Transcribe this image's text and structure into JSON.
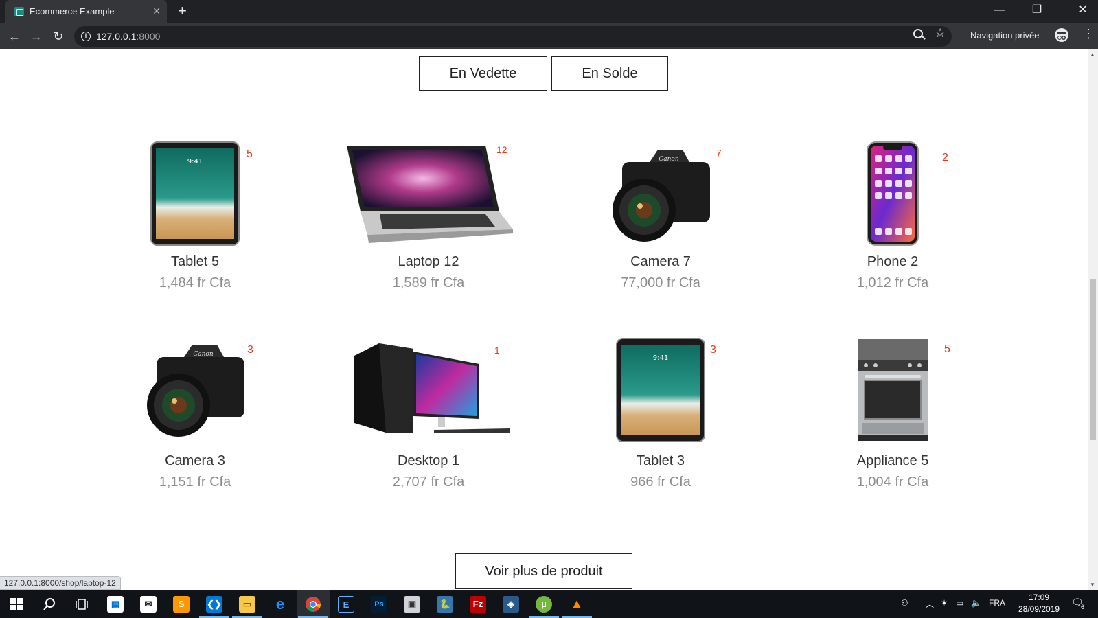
{
  "browser": {
    "tab_title": "Ecommerce Example",
    "tab_close": "✕",
    "new_tab": "+",
    "url_host": "127.0.0.1",
    "url_port": ":8000",
    "incognito_label": "Navigation privée",
    "window_controls": {
      "minimize": "—",
      "restore": "❐",
      "close": "✕"
    }
  },
  "filters": {
    "featured": "En Vedette",
    "sale": "En Solde"
  },
  "products": [
    {
      "name": "Tablet 5",
      "price": "1,484 fr Cfa",
      "badge": "5",
      "kind": "tablet"
    },
    {
      "name": "Laptop 12",
      "price": "1,589 fr Cfa",
      "badge": "12",
      "kind": "laptop"
    },
    {
      "name": "Camera 7",
      "price": "77,000 fr Cfa",
      "badge": "7",
      "kind": "camera"
    },
    {
      "name": "Phone 2",
      "price": "1,012 fr Cfa",
      "badge": "2",
      "kind": "phone"
    },
    {
      "name": "Camera 3",
      "price": "1,151 fr Cfa",
      "badge": "3",
      "kind": "camera"
    },
    {
      "name": "Desktop 1",
      "price": "2,707 fr Cfa",
      "badge": "1",
      "kind": "desktop"
    },
    {
      "name": "Tablet 3",
      "price": "966 fr Cfa",
      "badge": "3",
      "kind": "tablet"
    },
    {
      "name": "Appliance 5",
      "price": "1,004 fr Cfa",
      "badge": "5",
      "kind": "appliance"
    }
  ],
  "more_button": "Voir plus de produit",
  "status_url": "127.0.0.1:8000/shop/laptop-12",
  "taskbar": {
    "apps": [
      "windows-start",
      "search",
      "task-view",
      "store",
      "mail",
      "sublime-text",
      "vscode",
      "file-explorer",
      "edge",
      "chrome",
      "app-e",
      "photoshop",
      "photos",
      "python",
      "filezilla",
      "mysql-workbench",
      "utorrent",
      "vlc"
    ],
    "language": "FRA",
    "time": "17:09",
    "date": "28/09/2019",
    "notifications": "6"
  }
}
